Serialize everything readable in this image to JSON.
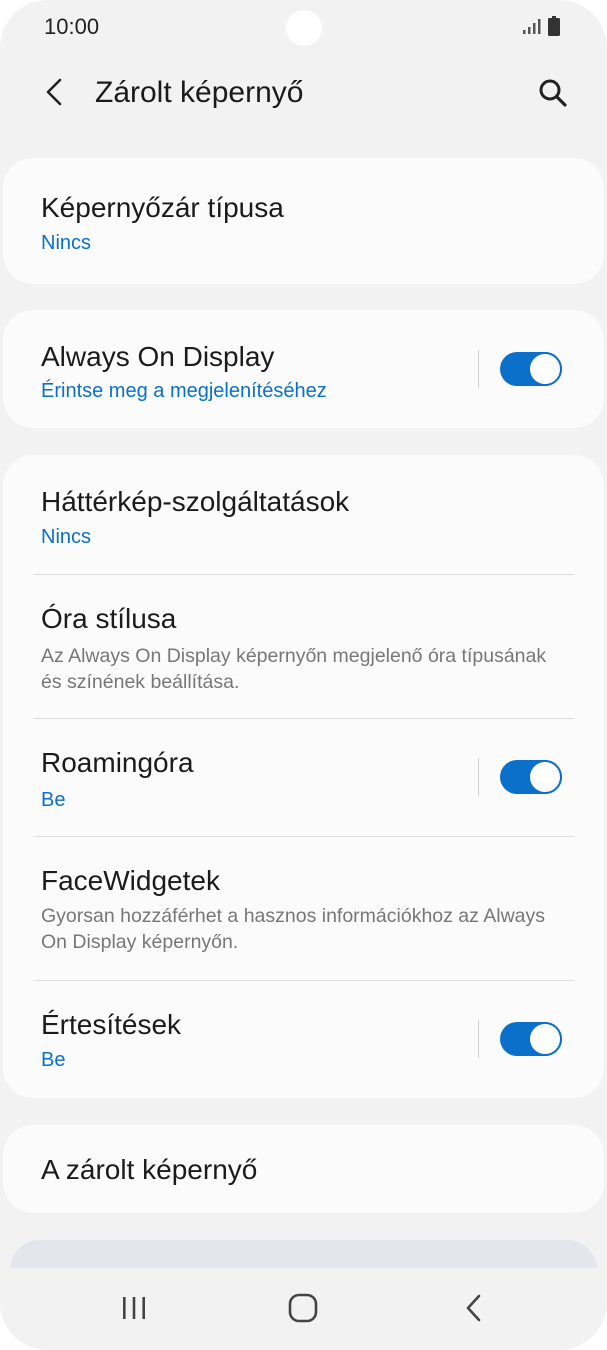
{
  "status_bar": {
    "time": "10:00",
    "signal_icon": "signal-icon",
    "battery_icon": "battery-icon"
  },
  "app_bar": {
    "title": "Zárolt képernyő",
    "back_icon": "back-arrow-icon",
    "search_icon": "search-icon"
  },
  "settings": {
    "lock_type": {
      "title": "Képernyőzár típusa",
      "value": "Nincs"
    },
    "aod": {
      "title": "Always On Display",
      "subtitle": "Érintse meg a megjelenítéséhez",
      "enabled": true
    },
    "wallpaper_services": {
      "title": "Háttérkép-szolgáltatások",
      "value": "Nincs"
    },
    "clock_style": {
      "title": "Óra stílusa",
      "subtitle": "Az Always On Display képernyőn megjelenő óra típusának és színének beállítása."
    },
    "roaming_clock": {
      "title": "Roamingóra",
      "value": "Be",
      "enabled": true
    },
    "facewidgets": {
      "title": "FaceWidgetek",
      "subtitle": "Gyorsan hozzáférhet a hasznos információkhoz az Always On Display képernyőn."
    },
    "notifications": {
      "title": "Értesítések",
      "value": "Be",
      "enabled": true
    },
    "about": {
      "title": "A zárolt képernyő"
    }
  },
  "colors": {
    "accent": "#0a70c9",
    "background": "#f2f2f2",
    "card": "#fbfbfb"
  },
  "nav_bar": {
    "recents_icon": "recents-icon",
    "home_icon": "home-icon",
    "back_icon": "nav-back-icon"
  }
}
